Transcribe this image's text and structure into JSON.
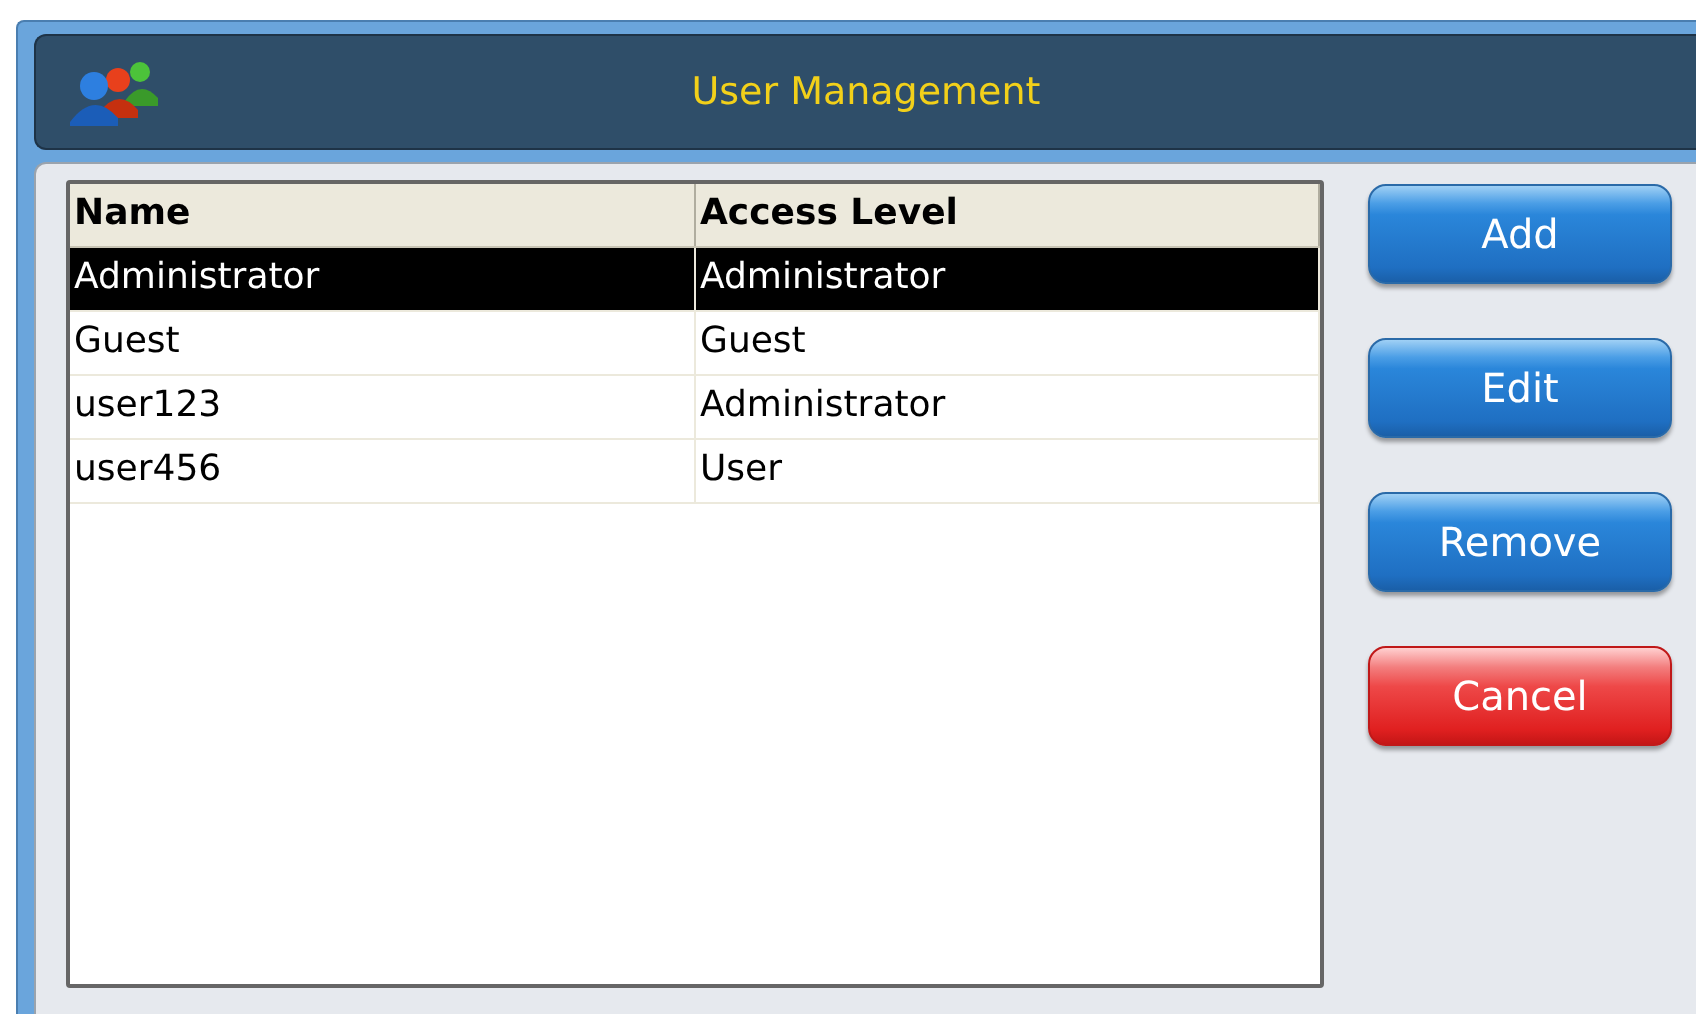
{
  "window": {
    "title": "User Management"
  },
  "table": {
    "columns": [
      "Name",
      "Access Level"
    ],
    "rows": [
      {
        "cells": [
          "Administrator",
          "Administrator"
        ],
        "selected": true
      },
      {
        "cells": [
          "Guest",
          "Guest"
        ],
        "selected": false
      },
      {
        "cells": [
          "user123",
          "Administrator"
        ],
        "selected": false
      },
      {
        "cells": [
          "user456",
          "User"
        ],
        "selected": false
      }
    ]
  },
  "buttons": [
    {
      "label": "Add",
      "kind": "primary"
    },
    {
      "label": "Edit",
      "kind": "primary"
    },
    {
      "label": "Remove",
      "kind": "primary"
    },
    {
      "label": "Cancel",
      "kind": "danger"
    }
  ]
}
